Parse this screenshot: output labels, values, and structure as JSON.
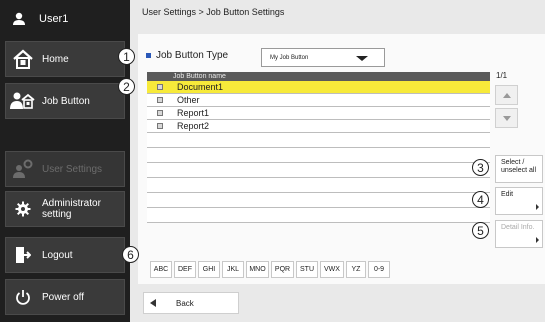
{
  "sidebar": {
    "user_label": "User1",
    "home_label": "Home",
    "job_button_label": "Job Button",
    "user_settings_label": "User Settings",
    "admin_label_line1": "Administrator",
    "admin_label_line2": "setting",
    "logout_label": "Logout",
    "power_off_label": "Power off"
  },
  "breadcrumb": "User Settings > Job Button Settings",
  "job_button_type": {
    "label": "Job Button Type",
    "selected": "My Job Button"
  },
  "table": {
    "header": "Job Button name",
    "rows": [
      {
        "name": "Document1",
        "selected": true
      },
      {
        "name": "Other",
        "selected": false
      },
      {
        "name": "Report1",
        "selected": false
      },
      {
        "name": "Report2",
        "selected": false
      }
    ]
  },
  "pager": "1/1",
  "actions": {
    "select_line1": "Select /",
    "select_line2": "unselect all",
    "edit": "Edit",
    "detail": "Detail Info."
  },
  "alpha_keys": [
    "ABC",
    "DEF",
    "GHI",
    "JKL",
    "MNO",
    "PQR",
    "STU",
    "VWX",
    "YZ",
    "0-9"
  ],
  "back_label": "Back",
  "callouts": [
    "1",
    "2",
    "3",
    "4",
    "5",
    "6"
  ],
  "colors": {
    "sidebar_bg": "#1f1f1f",
    "selected_row": "#f7ea3a",
    "accent_marker": "#2a58b8"
  }
}
